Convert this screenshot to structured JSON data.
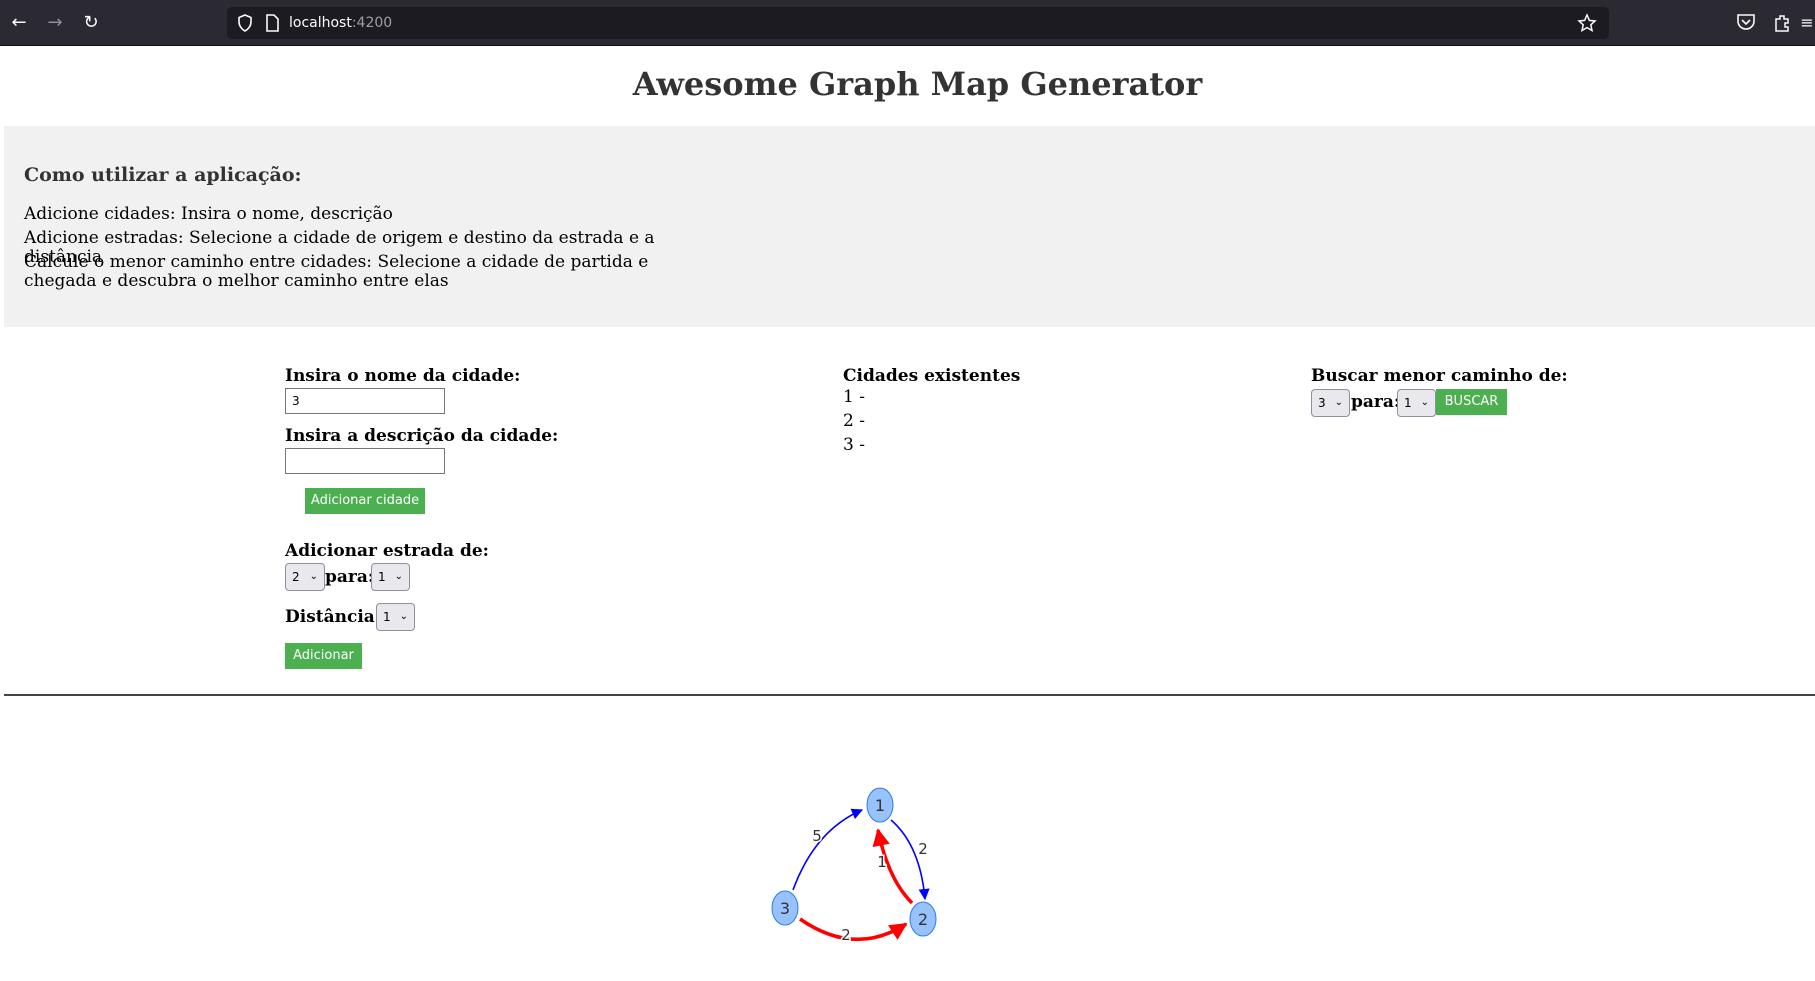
{
  "browser": {
    "url_host": "localhost",
    "url_port": ":4200"
  },
  "page": {
    "title": "Awesome Graph Map Generator"
  },
  "help": {
    "heading": "Como utilizar a aplicação:",
    "lines": [
      "Adicione cidades: Insira o nome, descrição",
      "Adicione estradas: Selecione a cidade de origem e destino da estrada e a distância",
      "Calcule o menor caminho entre cidades: Selecione a cidade de partida e chegada e descubra o melhor caminho entre elas"
    ]
  },
  "add_city": {
    "name_label": "Insira o nome da cidade:",
    "name_value": "3",
    "description_label": "Insira a descrição da cidade:",
    "description_value": "",
    "button": "Adicionar cidade"
  },
  "add_road": {
    "label": "Adicionar estrada de:",
    "from_value": "2",
    "to_label": "para:",
    "to_value": "1",
    "distance_label": "Distância:",
    "distance_value": "1",
    "button": "Adicionar"
  },
  "existing_cities": {
    "heading": "Cidades existentes",
    "items": [
      "1 -",
      "2 -",
      "3 -"
    ]
  },
  "shortest_path": {
    "label": "Buscar menor caminho de:",
    "from_value": "3",
    "to_label": "para:",
    "to_value": "1",
    "button": "BUSCAR"
  },
  "graph": {
    "nodes": [
      {
        "id": "1",
        "label": "1"
      },
      {
        "id": "2",
        "label": "2"
      },
      {
        "id": "3",
        "label": "3"
      }
    ],
    "edges": [
      {
        "from": "3",
        "to": "1",
        "weight": "5",
        "highlight": false
      },
      {
        "from": "1",
        "to": "2",
        "weight": "2",
        "highlight": false
      },
      {
        "from": "2",
        "to": "1",
        "weight": "1",
        "highlight": true
      },
      {
        "from": "3",
        "to": "2",
        "weight": "2",
        "highlight": true
      }
    ],
    "colors": {
      "node_fill": "#97c2fc",
      "node_border": "#2b7ce9",
      "edge_normal": "#0000ff",
      "edge_highlight": "#ff0000"
    }
  },
  "colors": {
    "button_green": "#4caf50",
    "help_bg": "#f1f1f1"
  }
}
